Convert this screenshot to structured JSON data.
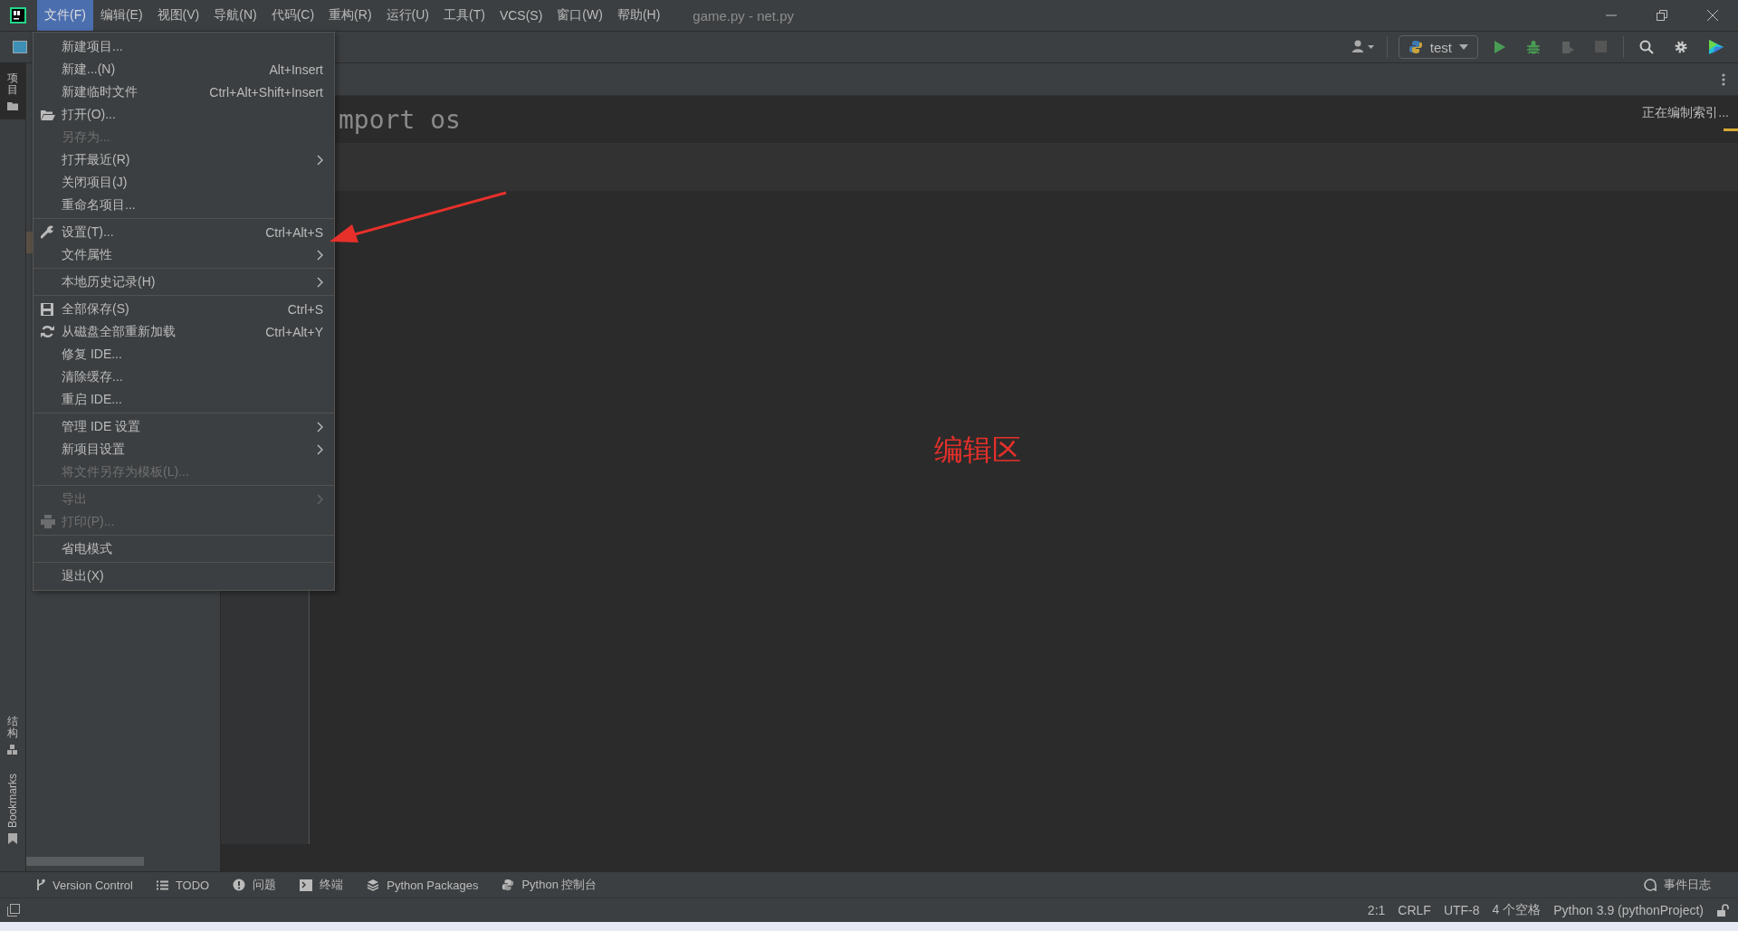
{
  "title_bar": {
    "menus": [
      {
        "label": "文件(F)",
        "selected": true
      },
      {
        "label": "编辑(E)",
        "selected": false
      },
      {
        "label": "视图(V)",
        "selected": false
      },
      {
        "label": "导航(N)",
        "selected": false
      },
      {
        "label": "代码(C)",
        "selected": false
      },
      {
        "label": "重构(R)",
        "selected": false
      },
      {
        "label": "运行(U)",
        "selected": false
      },
      {
        "label": "工具(T)",
        "selected": false
      },
      {
        "label": "VCS(S)",
        "selected": false
      },
      {
        "label": "窗口(W)",
        "selected": false
      },
      {
        "label": "帮助(H)",
        "selected": false
      }
    ],
    "title": "game.py - net.py"
  },
  "toolbar": {
    "run_config": "test"
  },
  "left_strip": {
    "tabs": [
      {
        "label": "项目",
        "selected": true
      },
      {
        "label": "结构",
        "selected": false
      },
      {
        "label": "Bookmarks",
        "selected": false
      }
    ]
  },
  "editor": {
    "sticky_line": "mport os",
    "indexing_status": "正在编制索引...",
    "annotation": "编辑区"
  },
  "file_menu": {
    "groups": [
      {
        "items": [
          {
            "label": "新建项目...",
            "submenu": false,
            "disabled": false
          },
          {
            "label": "新建...(N)",
            "shortcut": "Alt+Insert",
            "submenu": false,
            "disabled": false
          },
          {
            "label": "新建临时文件",
            "shortcut": "Ctrl+Alt+Shift+Insert",
            "submenu": false,
            "disabled": false
          },
          {
            "label": "打开(O)...",
            "submenu": false,
            "disabled": false
          },
          {
            "label": "另存为...",
            "submenu": false,
            "disabled": true
          },
          {
            "label": "打开最近(R)",
            "submenu": true,
            "disabled": false
          },
          {
            "label": "关闭项目(J)",
            "submenu": false,
            "disabled": false
          },
          {
            "label": "重命名项目...",
            "submenu": false,
            "disabled": false
          }
        ]
      },
      {
        "items": [
          {
            "label": "设置(T)...",
            "shortcut": "Ctrl+Alt+S",
            "submenu": false,
            "disabled": false
          },
          {
            "label": "文件属性",
            "submenu": true,
            "disabled": false
          }
        ]
      },
      {
        "items": [
          {
            "label": "本地历史记录(H)",
            "submenu": true,
            "disabled": false
          }
        ]
      },
      {
        "items": [
          {
            "label": "全部保存(S)",
            "shortcut": "Ctrl+S",
            "submenu": false,
            "disabled": false
          },
          {
            "label": "从磁盘全部重新加载",
            "shortcut": "Ctrl+Alt+Y",
            "submenu": false,
            "disabled": false
          },
          {
            "label": "修复 IDE...",
            "submenu": false,
            "disabled": false
          },
          {
            "label": "清除缓存...",
            "submenu": false,
            "disabled": false
          },
          {
            "label": "重启 IDE...",
            "submenu": false,
            "disabled": false
          }
        ]
      },
      {
        "items": [
          {
            "label": "管理 IDE 设置",
            "submenu": true,
            "disabled": false
          },
          {
            "label": "新项目设置",
            "submenu": true,
            "disabled": false
          },
          {
            "label": "将文件另存为模板(L)...",
            "submenu": false,
            "disabled": true
          }
        ]
      },
      {
        "items": [
          {
            "label": "导出",
            "submenu": true,
            "disabled": true
          },
          {
            "label": "打印(P)...",
            "submenu": false,
            "disabled": true
          }
        ]
      },
      {
        "items": [
          {
            "label": "省电模式",
            "submenu": false,
            "disabled": false
          }
        ]
      },
      {
        "items": [
          {
            "label": "退出(X)",
            "submenu": false,
            "disabled": false
          }
        ]
      }
    ]
  },
  "tool_windows": [
    "Version Control",
    "TODO",
    "问题",
    "终端",
    "Python Packages",
    "Python 控制台"
  ],
  "event_log": "事件日志",
  "status_bar": [
    "2:1",
    "CRLF",
    "UTF-8",
    "4 个空格",
    "Python 3.9 (pythonProject)"
  ]
}
